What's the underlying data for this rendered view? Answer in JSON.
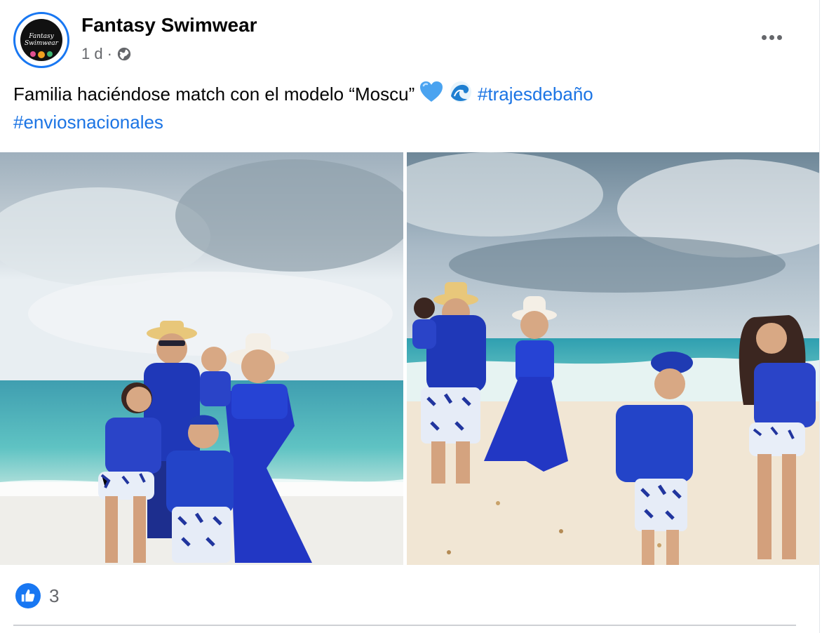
{
  "post": {
    "page_name": "Fantasy Swimwear",
    "avatar_text_line1": "Fantasy",
    "avatar_text_line2": "Swimwear",
    "time": "1 d",
    "separator": "·",
    "privacy_icon": "globe-icon",
    "more_icon": "more-options-icon",
    "caption_text": "Familia haciéndose match con el modelo “Moscu” ",
    "caption_emojis": [
      "blue-heart",
      "water-wave"
    ],
    "hashtags": [
      "#trajesdebaño",
      "#enviosnacionales"
    ],
    "photos": [
      {
        "name": "family-posing-beach-photo"
      },
      {
        "name": "family-walking-beach-photo"
      }
    ],
    "reaction_icon": "like-icon",
    "reaction_count": "3"
  },
  "colors": {
    "link": "#1b74e4",
    "accent": "#1877f2",
    "secondary_text": "#65676b",
    "divider": "#ced0d4"
  }
}
